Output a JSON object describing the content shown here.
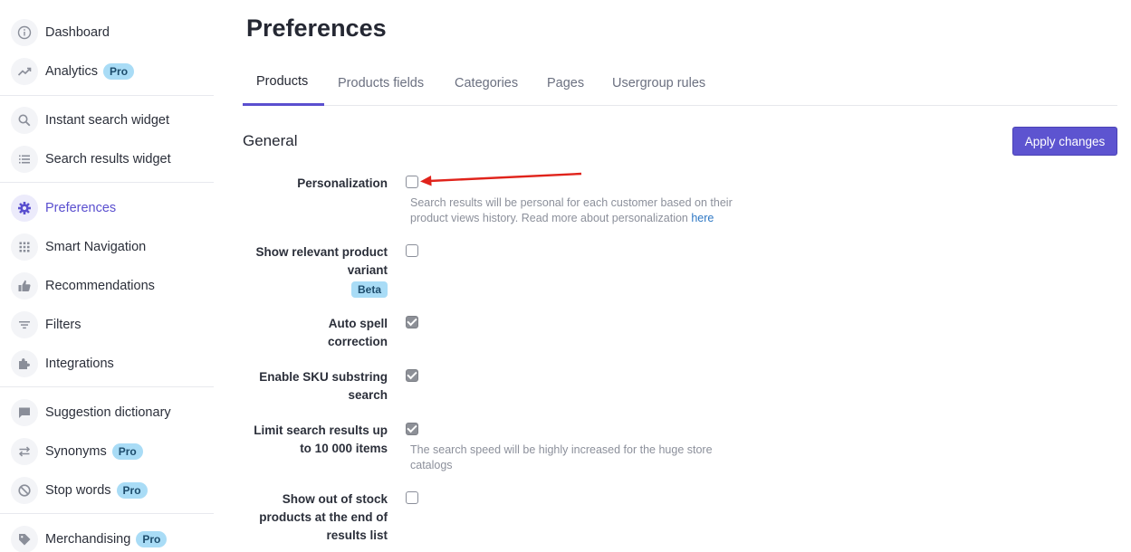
{
  "sidebar": {
    "items": [
      {
        "label": "Dashboard",
        "icon": "info-icon"
      },
      {
        "label": "Analytics",
        "icon": "trend-icon",
        "badge": "Pro"
      },
      {
        "label": "Instant search widget",
        "icon": "search-icon"
      },
      {
        "label": "Search results widget",
        "icon": "list-icon"
      },
      {
        "label": "Preferences",
        "icon": "gear-icon",
        "active": true
      },
      {
        "label": "Smart Navigation",
        "icon": "grid-icon"
      },
      {
        "label": "Recommendations",
        "icon": "thumbs-up-icon"
      },
      {
        "label": "Filters",
        "icon": "filter-icon"
      },
      {
        "label": "Integrations",
        "icon": "puzzle-icon"
      },
      {
        "label": "Suggestion dictionary",
        "icon": "chat-icon"
      },
      {
        "label": "Synonyms",
        "icon": "swap-icon",
        "badge": "Pro"
      },
      {
        "label": "Stop words",
        "icon": "block-icon",
        "badge": "Pro"
      },
      {
        "label": "Merchandising",
        "icon": "tag-icon",
        "badge": "Pro"
      }
    ]
  },
  "page": {
    "title": "Preferences"
  },
  "tabs": [
    {
      "label": "Products",
      "active": true
    },
    {
      "label": "Products fields"
    },
    {
      "label": "Categories"
    },
    {
      "label": "Pages"
    },
    {
      "label": "Usergroup rules"
    }
  ],
  "section": {
    "title": "General",
    "apply_label": "Apply changes"
  },
  "options": {
    "personalization": {
      "label": "Personalization",
      "checked": false,
      "help": "Search results will be personal for each customer based on their product views history. Read more about personalization",
      "help_link": "here"
    },
    "relevant_variant": {
      "label_line1": "Show relevant product",
      "label_line2": "variant",
      "badge": "Beta",
      "checked": false
    },
    "auto_spell": {
      "label_line1": "Auto spell",
      "label_line2": "correction",
      "checked": true
    },
    "sku_substring": {
      "label_line1": "Enable SKU substring",
      "label_line2": "search",
      "checked": true
    },
    "limit_results": {
      "label_line1": "Limit search results up",
      "label_line2": "to 10 000 items",
      "checked": true,
      "help": "The search speed will be highly increased for the huge store catalogs"
    },
    "out_of_stock": {
      "label_line1": "Show out of stock",
      "label_line2": "products at the end of",
      "label_line3": "results list",
      "checked": false
    }
  },
  "colors": {
    "accent": "#5d54d0",
    "badge": "#a9dcf6",
    "arrow": "#e0231b"
  }
}
